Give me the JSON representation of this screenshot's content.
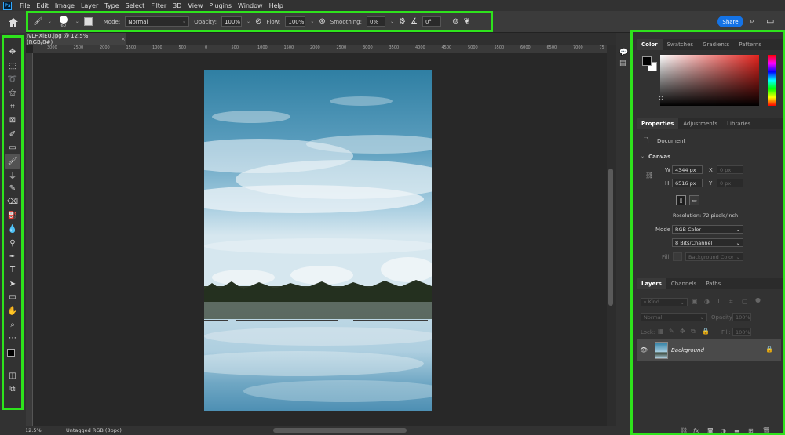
{
  "menubar": {
    "logo": "Ps",
    "items": [
      "File",
      "Edit",
      "Image",
      "Layer",
      "Type",
      "Select",
      "Filter",
      "3D",
      "View",
      "Plugins",
      "Window",
      "Help"
    ]
  },
  "options": {
    "brush_size": "60",
    "mode_label": "Mode:",
    "mode_value": "Normal",
    "opacity_label": "Opacity:",
    "opacity_value": "100%",
    "flow_label": "Flow:",
    "flow_value": "100%",
    "smoothing_label": "Smoothing:",
    "smoothing_value": "0%",
    "angle_value": "0°"
  },
  "share_label": "Share",
  "document": {
    "tab_title": "JvLHXiEU.jpg @ 12.5% (RGB/8#)",
    "close": "×",
    "zoom": "12.5%",
    "status": "Untagged RGB (8bpc)"
  },
  "ruler_top": [
    "3000",
    "2500",
    "2000",
    "1500",
    "1000",
    "500",
    "0",
    "500",
    "1000",
    "1500",
    "2000",
    "2500",
    "3000",
    "3500",
    "4000",
    "4500",
    "5000",
    "5500",
    "6000",
    "6500",
    "7000",
    "75"
  ],
  "color_panel": {
    "tabs": [
      "Color",
      "Swatches",
      "Gradients",
      "Patterns"
    ],
    "hue_color": "#e5231d"
  },
  "properties_panel": {
    "tabs": [
      "Properties",
      "Adjustments",
      "Libraries"
    ],
    "doc_label": "Document",
    "canvas_label": "Canvas",
    "w_label": "W",
    "w_value": "4344 px",
    "h_label": "H",
    "h_value": "6516 px",
    "x_label": "X",
    "x_value": "0 px",
    "y_label": "Y",
    "y_value": "0 px",
    "resolution": "Resolution: 72 pixels/inch",
    "mode_label": "Mode",
    "mode_value": "RGB Color",
    "depth_value": "8 Bits/Channel",
    "fill_label": "Fill",
    "fill_value": "Background Color"
  },
  "layers_panel": {
    "tabs": [
      "Layers",
      "Channels",
      "Paths"
    ],
    "kind_label": "Kind",
    "blend_mode": "Normal",
    "opacity_label": "Opacity:",
    "opacity_value": "100%",
    "lock_label": "Lock:",
    "fill_label": "Fill:",
    "fill_value": "100%",
    "layer_name": "Background"
  }
}
